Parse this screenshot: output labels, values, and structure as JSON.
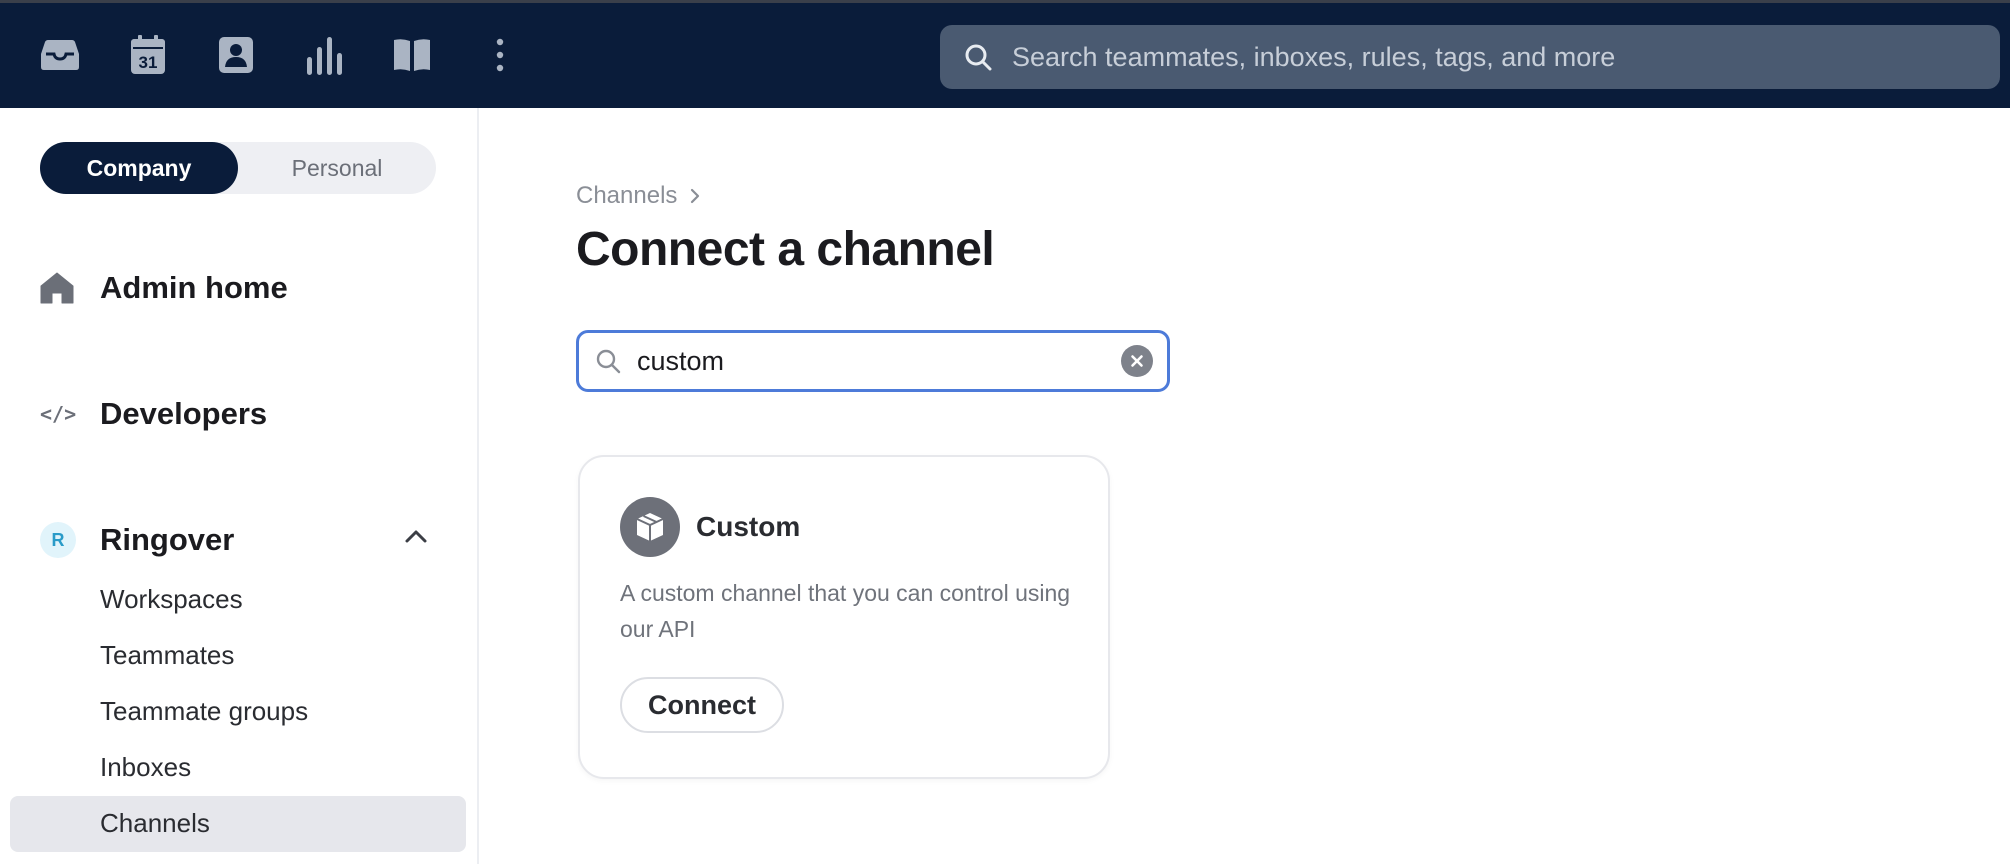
{
  "topbar": {
    "icons": [
      "inbox-icon",
      "calendar-icon",
      "contacts-icon",
      "analytics-icon",
      "knowledge-base-icon",
      "more-icon"
    ],
    "calendar_day": "31",
    "search_placeholder": "Search teammates, inboxes, rules, tags, and more"
  },
  "sidebar": {
    "scope": {
      "company_label": "Company",
      "personal_label": "Personal",
      "selected": "Company"
    },
    "admin_home": "Admin home",
    "developers": "Developers",
    "developers_glyph": "</>",
    "workspace": {
      "initial": "R",
      "name": "Ringover",
      "expanded": true,
      "items": [
        "Workspaces",
        "Teammates",
        "Teammate groups",
        "Inboxes",
        "Channels"
      ],
      "selected": "Channels"
    }
  },
  "main": {
    "breadcrumb": "Channels",
    "title": "Connect a channel",
    "search": {
      "value": "custom"
    },
    "results": [
      {
        "name": "Custom",
        "description": "A custom channel that you can control using our API",
        "action": "Connect",
        "icon": "package-icon"
      }
    ]
  },
  "colors": {
    "topbar_bg": "#0a1c3a",
    "search_bg": "#4a5a71",
    "focus_ring": "#4d7bd9",
    "selected_nav_bg": "#e6e7ec"
  }
}
